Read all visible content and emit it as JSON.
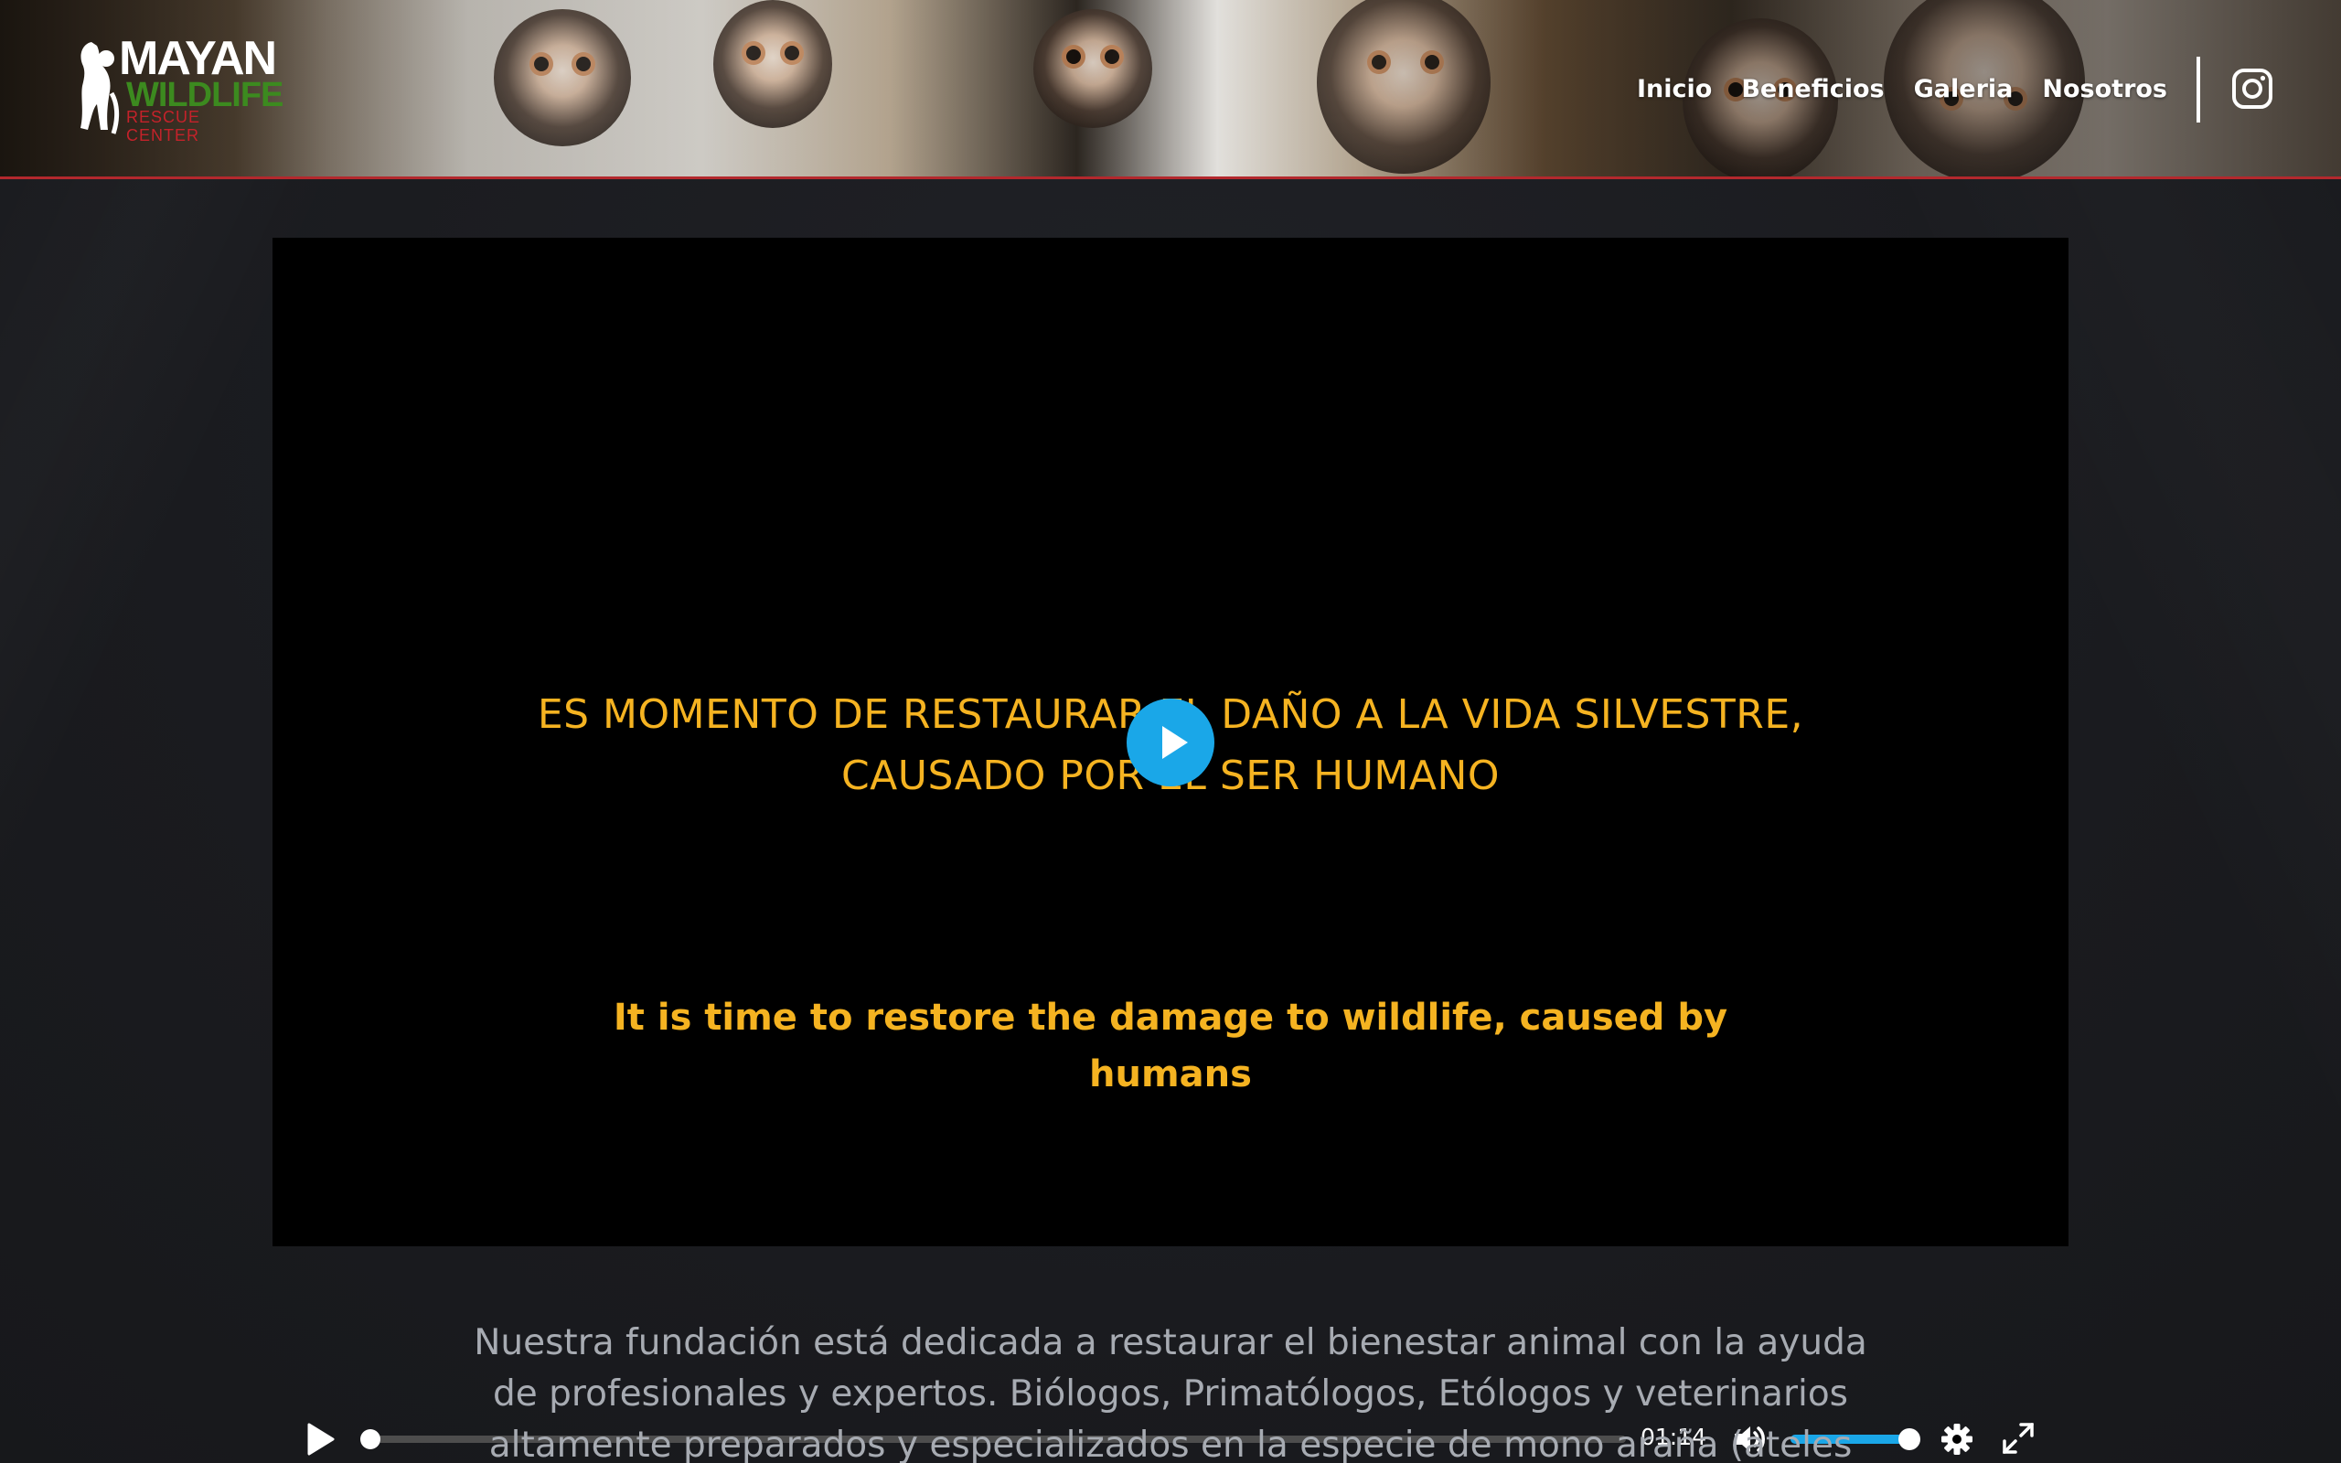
{
  "header": {
    "logo": {
      "line1": "MAYAN",
      "line2": "WILDLIFE",
      "line3": "RESCUE CENTER"
    },
    "nav": [
      {
        "label": "Inicio"
      },
      {
        "label": "Beneficios"
      },
      {
        "label": "Galeria"
      },
      {
        "label": "Nosotros"
      }
    ],
    "social_icon": "instagram-icon",
    "border_color": "#b3282d"
  },
  "video": {
    "caption_es_line1": "ES MOMENTO DE RESTAURAR EL DAÑO A LA VIDA SILVESTRE,",
    "caption_es_line2": "CAUSADO POR EL SER HUMANO",
    "caption_en_line1": "It is time to restore the damage to wildlife, caused by",
    "caption_en_line2": "humans",
    "caption_color": "#f5b321",
    "accent_color": "#1aa7e8",
    "duration": "01:14",
    "progress": 0,
    "volume": 1.0,
    "icons": {
      "big_play": "play-icon",
      "play": "play-icon",
      "volume": "volume-icon",
      "settings": "gear-icon",
      "fullscreen": "fullscreen-icon"
    }
  },
  "description": "Nuestra fundación está dedicada a restaurar el bienestar animal con la ayuda de profesionales y expertos. Biólogos, Primatólogos, Etólogos y veterinarios altamente preparados y especializados en la especie de mono araña (ateles geoffroyi)"
}
